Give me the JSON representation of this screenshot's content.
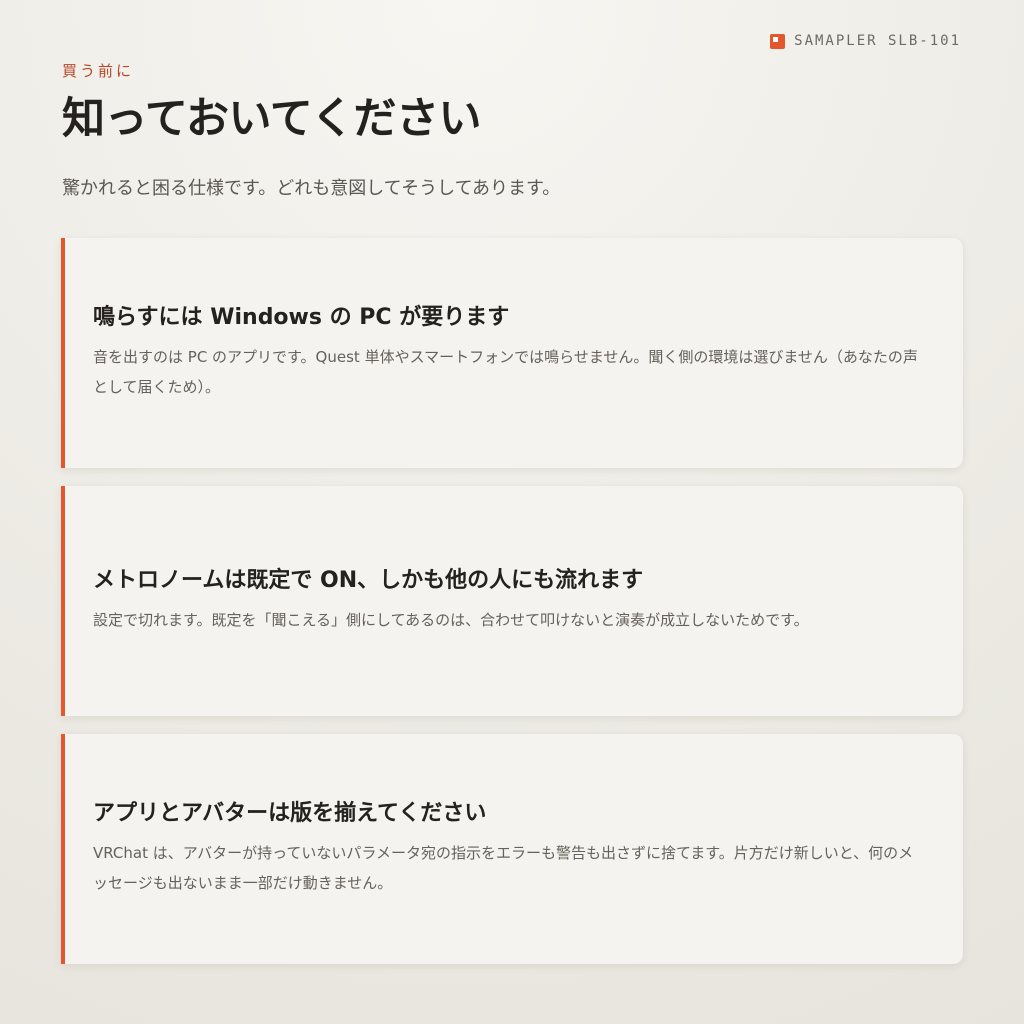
{
  "header": {
    "brand_text": "SAMAPLER SLB-101",
    "brand_icon": "square-logo-icon",
    "accent_color": "#e4572e"
  },
  "hero": {
    "eyebrow": "買う前に",
    "title": "知っておいてください",
    "subtitle": "驚かれると困る仕様です。どれも意図してそうしてあります。"
  },
  "cards": [
    {
      "title": "鳴らすには Windows の PC が要ります",
      "body": "音を出すのは PC のアプリです。Quest 単体やスマートフォンでは鳴らせません。聞く側の環境は選びません（あなたの声として届くため）。"
    },
    {
      "title": "メトロノームは既定で ON、しかも他の人にも流れます",
      "body": "設定で切れます。既定を「聞こえる」側にしてあるのは、合わせて叩けないと演奏が成立しないためです。"
    },
    {
      "title": "アプリとアバターは版を揃えてください",
      "body": "VRChat は、アバターが持っていないパラメータ宛の指示をエラーも警告も出さずに捨てます。片方だけ新しいと、何のメッセージも出ないまま一部だけ動きません。"
    }
  ]
}
